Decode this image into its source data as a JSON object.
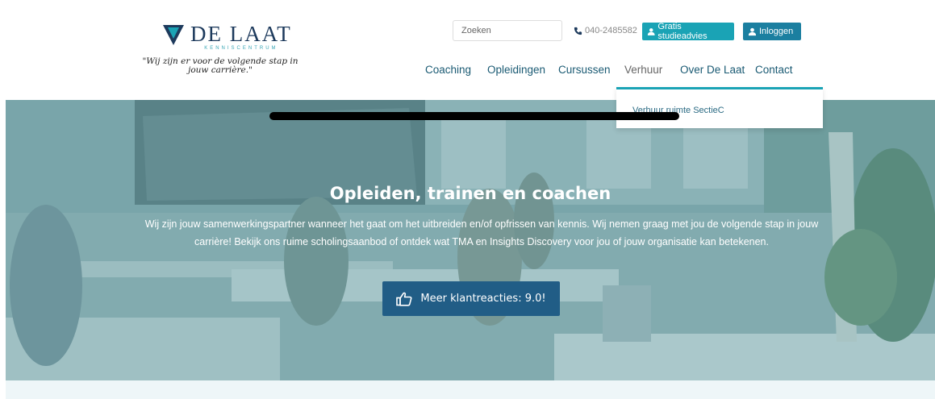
{
  "brand": {
    "name": "DE LAAT",
    "subtitle": "KENNISCENTRUM",
    "tagline": "\"Wij zijn er voor de volgende stap in jouw carrière.\""
  },
  "topbar": {
    "search_placeholder": "Zoeken",
    "phone": "040-2485582",
    "advies_label": "Gratis studieadvies",
    "login_label": "Inloggen"
  },
  "nav": {
    "items": [
      {
        "label": "Coaching"
      },
      {
        "label": "Opleidingen"
      },
      {
        "label": "Cursussen"
      },
      {
        "label": "Verhuur"
      },
      {
        "label": "Over De Laat"
      },
      {
        "label": "Contact"
      }
    ],
    "active": "Verhuur"
  },
  "dropdown": {
    "items": [
      {
        "label": "Verhuur ruimte SectieC"
      }
    ]
  },
  "hero": {
    "title": "Opleiden, trainen en coachen",
    "text": "Wij zijn jouw samenwerkingspartner wanneer het gaat om het uitbreiden en/of opfrissen van kennis. Wij nemen graag met jou de volgende stap in jouw carrière! Bekijk ons ruime scholingsaanbod of ontdek wat TMA en Insights Discovery voor jou of jouw organisatie kan betekenen.",
    "cta_label": "Meer klantreacties: 9.0!"
  },
  "colors": {
    "brand_navy": "#1d3a5c",
    "accent_teal": "#1aa3b5",
    "login_blue": "#1b7fa0",
    "cta_blue": "#215d86"
  }
}
